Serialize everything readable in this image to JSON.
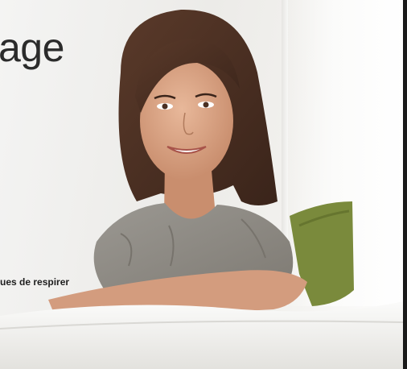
{
  "banner": {
    "headline": "age",
    "tagline": "ues de respirer"
  },
  "image": {
    "subject": "smiling-woman-on-sofa-photo"
  },
  "colors": {
    "headline": "#2b2b2b",
    "sofa": "#f3f2ef",
    "cushion": "#7a8a3c",
    "blouse": "#8f8b85",
    "hair": "#4a2f22",
    "skin": "#d9a487"
  }
}
